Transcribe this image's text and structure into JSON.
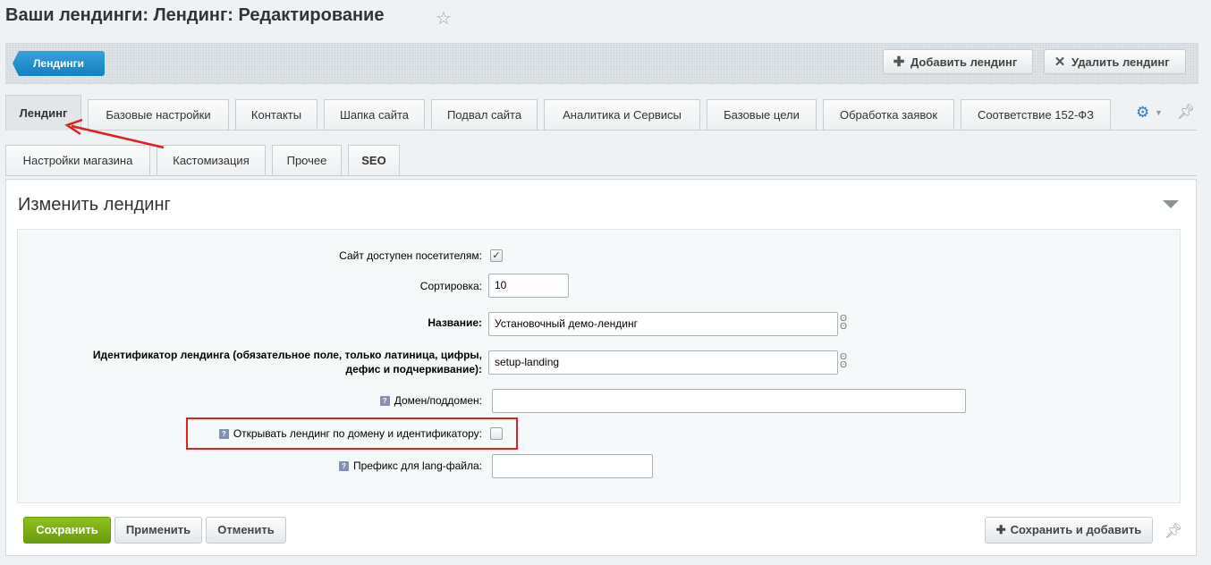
{
  "page": {
    "title": "Ваши лендинги: Лендинг: Редактирование"
  },
  "toolbar": {
    "back_label": "Лендинги",
    "add_label": "Добавить лендинг",
    "delete_label": "Удалить лендинг"
  },
  "tabs": [
    {
      "label": "Лендинг",
      "active": true
    },
    {
      "label": "Базовые настройки"
    },
    {
      "label": "Контакты"
    },
    {
      "label": "Шапка сайта"
    },
    {
      "label": "Подвал сайта"
    },
    {
      "label": "Аналитика и Сервисы"
    },
    {
      "label": "Базовые цели"
    },
    {
      "label": "Обработка заявок"
    },
    {
      "label": "Соответствие 152-ФЗ"
    }
  ],
  "tabs_row2": [
    {
      "label": "Настройки магазина"
    },
    {
      "label": "Кастомизация"
    },
    {
      "label": "Прочее"
    },
    {
      "label": "SEO"
    }
  ],
  "panel": {
    "title": "Изменить лендинг"
  },
  "form": {
    "active_label": "Сайт доступен посетителям:",
    "active_checked": true,
    "sort_label": "Сортировка:",
    "sort_value": "10",
    "name_label": "Название:",
    "name_value": "Установочный демо-лендинг",
    "code_label_line1": "Идентификатор лендинга (обязательное поле, только латиница, цифры,",
    "code_label_line2": "дефис и подчеркивание):",
    "code_value": "setup-landing",
    "domain_label": "Домен/поддомен:",
    "domain_value": "",
    "open_by_domain_label": "Открывать лендинг по домену и идентификатору:",
    "open_by_domain_checked": false,
    "lang_prefix_label": "Префикс для lang-файла:",
    "lang_prefix_value": "",
    "hint_glyph": "?"
  },
  "buttons": {
    "save": "Сохранить",
    "apply": "Применить",
    "cancel": "Отменить",
    "save_and_add": "Сохранить и добавить"
  },
  "colors": {
    "accent_blue": "#1380c2",
    "save_green": "#6a9b0b",
    "highlight_red": "#e0201f"
  },
  "icons": [
    "star-icon",
    "plus-icon",
    "close-icon",
    "gear-icon",
    "pin-icon",
    "chain-link-icon",
    "help-icon",
    "collapse-triangle-icon"
  ]
}
